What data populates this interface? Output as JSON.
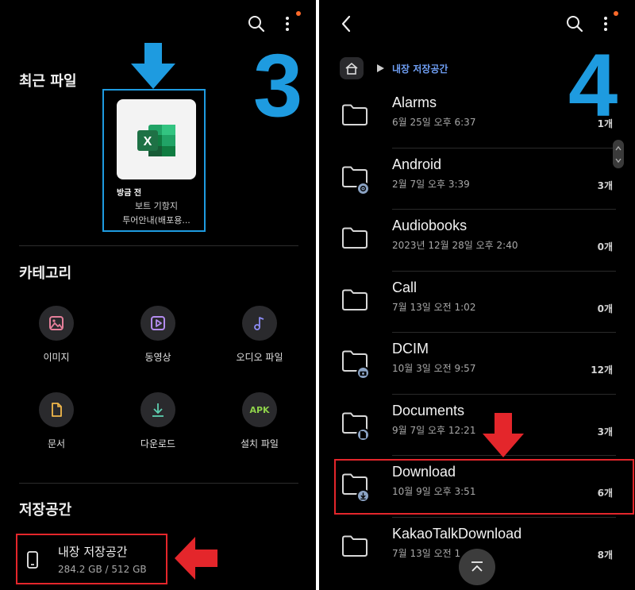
{
  "colors": {
    "accent_blue": "#1e9be0",
    "highlight_red": "#e4262b",
    "notification_dot": "#ff6a2a",
    "breadcrumb_blue": "#6f9ff5",
    "excel_green": "#1e7145"
  },
  "left_screen": {
    "step_number": "3",
    "top_icons": [
      "search-icon",
      "more-vert-icon"
    ],
    "recent": {
      "title": "최근 파일",
      "item": {
        "time_label": "방금 전",
        "name_line1": "보트 기항지",
        "name_line2": "투어안내(배포용...",
        "icon": "excel-icon"
      }
    },
    "categories": {
      "title": "카테고리",
      "items": [
        {
          "label": "이미지",
          "icon": "image-icon"
        },
        {
          "label": "동영상",
          "icon": "video-icon"
        },
        {
          "label": "오디오 파일",
          "icon": "music-icon"
        },
        {
          "label": "문서",
          "icon": "document-icon"
        },
        {
          "label": "다운로드",
          "icon": "download-icon"
        },
        {
          "label": "설치 파일",
          "icon": "apk-icon",
          "glyph": "APK"
        }
      ]
    },
    "storage": {
      "title": "저장공간",
      "item": {
        "name": "내장 저장공간",
        "size": "284.2 GB / 512 GB",
        "icon": "phone-icon"
      }
    }
  },
  "right_screen": {
    "step_number": "4",
    "top_icons": [
      "back-icon",
      "search-icon",
      "more-vert-icon"
    ],
    "breadcrumb": {
      "home_icon": "home-icon",
      "separator_icon": "play-arrow-icon",
      "label": "내장 저장공간"
    },
    "folders": [
      {
        "name": "Alarms",
        "date": "6월 25일 오후 6:37",
        "count": "1개",
        "badge": ""
      },
      {
        "name": "Android",
        "date": "2월 7일 오후 3:39",
        "count": "3개",
        "badge": "gear-icon"
      },
      {
        "name": "Audiobooks",
        "date": "2023년 12월 28일 오후 2:40",
        "count": "0개",
        "badge": ""
      },
      {
        "name": "Call",
        "date": "7월 13일 오전 1:02",
        "count": "0개",
        "badge": ""
      },
      {
        "name": "DCIM",
        "date": "10월 3일 오전 9:57",
        "count": "12개",
        "badge": "camera-icon"
      },
      {
        "name": "Documents",
        "date": "9월 7일 오후 12:21",
        "count": "3개",
        "badge": "doc-icon"
      },
      {
        "name": "Download",
        "date": "10월 9일 오후 3:51",
        "count": "6개",
        "badge": "download-icon"
      },
      {
        "name": "KakaoTalkDownload",
        "date": "7월 13일 오전 1",
        "count": "8개",
        "badge": ""
      }
    ],
    "scroll_top_icon": "scroll-top-icon"
  }
}
